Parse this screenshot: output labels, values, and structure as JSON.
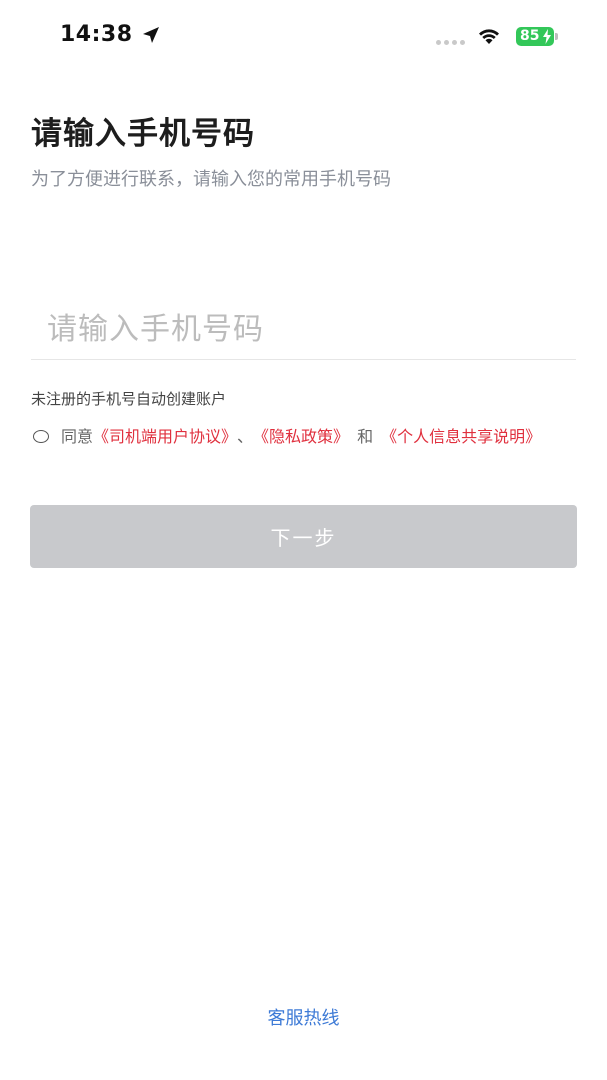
{
  "status_bar": {
    "time": "14:38",
    "battery": "85"
  },
  "header": {
    "title": "请输入手机号码",
    "subtitle": "为了方便进行联系，请输入您的常用手机号码"
  },
  "phone_input": {
    "placeholder": "请输入手机号码",
    "value": ""
  },
  "notice": "未注册的手机号自动创建账户",
  "agreement": {
    "prefix": "同意",
    "user_agreement": "《司机端用户协议》",
    "separator": "、",
    "privacy_policy": "《隐私政策》",
    "conjunction": "和",
    "info_sharing": "《个人信息共享说明》"
  },
  "next_button": {
    "label": "下一步"
  },
  "hotline": {
    "label": "客服热线"
  },
  "colors": {
    "link": "#e0303e",
    "button_disabled": "#c8c9cc",
    "hotline": "#3d7ad6",
    "battery": "#33c759"
  }
}
